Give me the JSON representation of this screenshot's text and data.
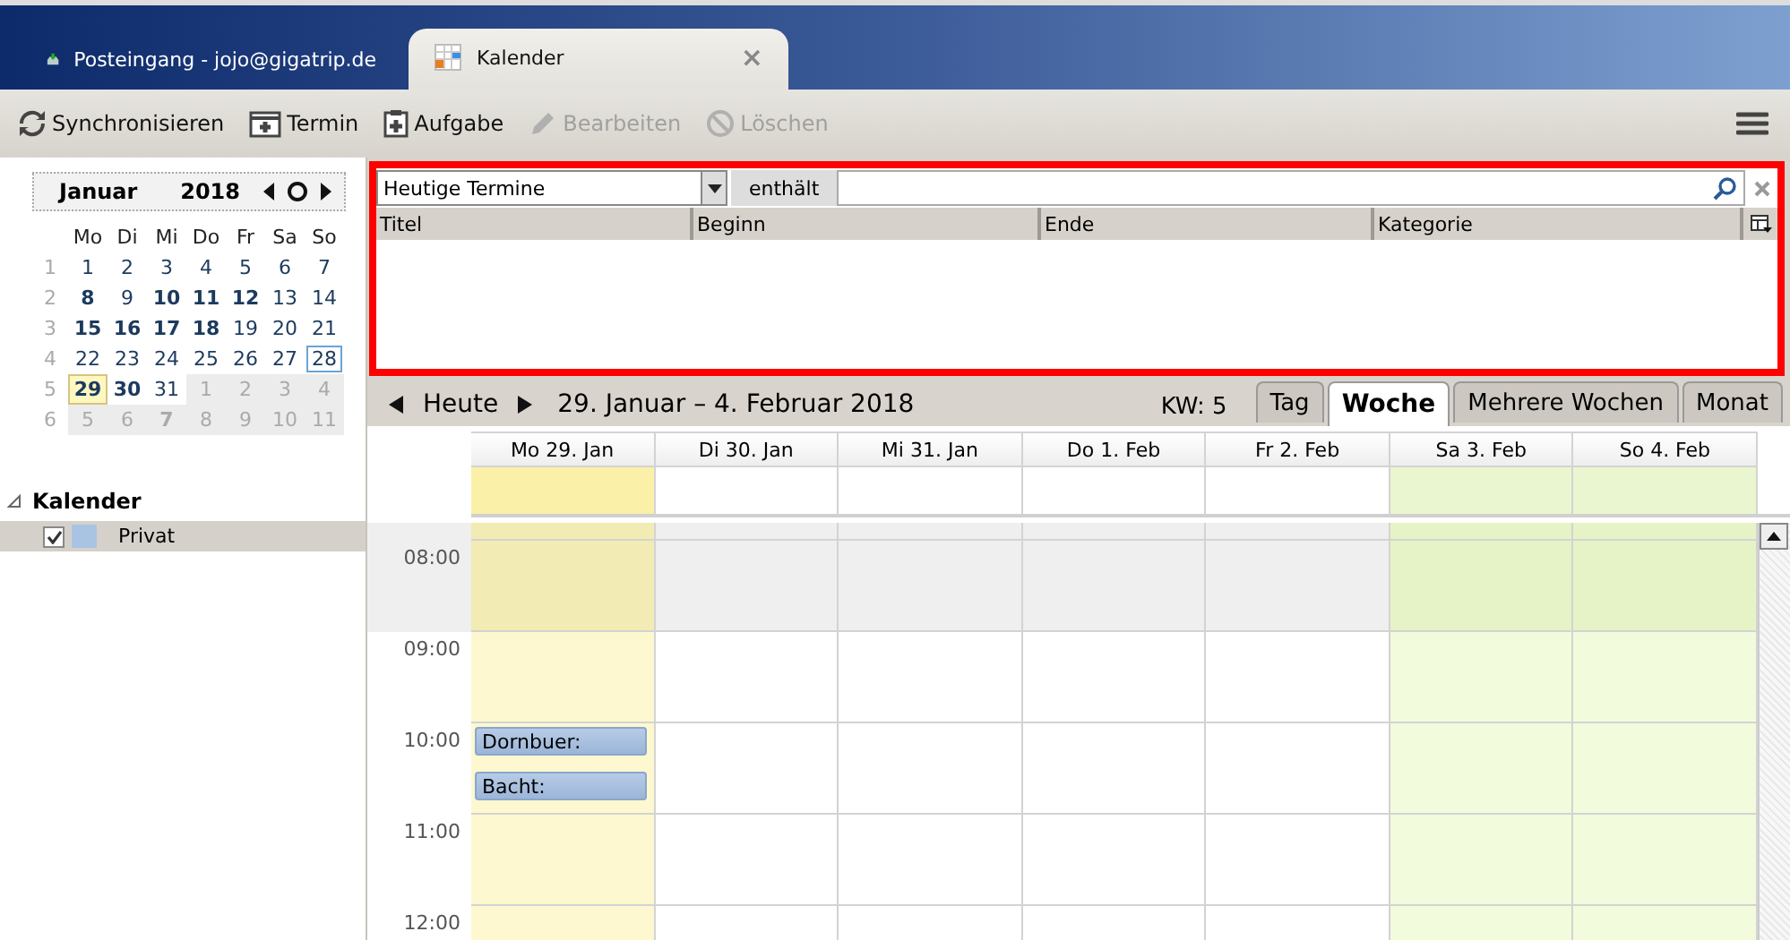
{
  "tabs": [
    {
      "label": "Posteingang - jojo@gigatrip.de",
      "kind": "mail",
      "selected": false
    },
    {
      "label": "Kalender",
      "kind": "calendar",
      "selected": true,
      "close": "×"
    }
  ],
  "toolbar": [
    {
      "label": "Synchronisieren",
      "kind": "sync",
      "disabled": false
    },
    {
      "label": "Termin",
      "kind": "event",
      "disabled": false
    },
    {
      "label": "Aufgabe",
      "kind": "task",
      "disabled": false
    },
    {
      "label": "Bearbeiten",
      "kind": "edit",
      "disabled": true
    },
    {
      "label": "Löschen",
      "kind": "delete",
      "disabled": true
    }
  ],
  "minicalendar": {
    "month": "Januar",
    "year": "2018",
    "weekdays": [
      "Mo",
      "Di",
      "Mi",
      "Do",
      "Fr",
      "Sa",
      "So"
    ],
    "weeks": [
      {
        "number": "1",
        "days": [
          {
            "day": "1",
            "bold": false,
            "outside": false,
            "today": false,
            "selected": false
          },
          {
            "day": "2",
            "bold": false,
            "outside": false,
            "today": false,
            "selected": false
          },
          {
            "day": "3",
            "bold": false,
            "outside": false,
            "today": false,
            "selected": false
          },
          {
            "day": "4",
            "bold": false,
            "outside": false,
            "today": false,
            "selected": false
          },
          {
            "day": "5",
            "bold": false,
            "outside": false,
            "today": false,
            "selected": false
          },
          {
            "day": "6",
            "bold": false,
            "outside": false,
            "today": false,
            "selected": false
          },
          {
            "day": "7",
            "bold": false,
            "outside": false,
            "today": false,
            "selected": false
          }
        ]
      },
      {
        "number": "2",
        "days": [
          {
            "day": "8",
            "bold": true,
            "outside": false,
            "today": false,
            "selected": false
          },
          {
            "day": "9",
            "bold": false,
            "outside": false,
            "today": false,
            "selected": false
          },
          {
            "day": "10",
            "bold": true,
            "outside": false,
            "today": false,
            "selected": false
          },
          {
            "day": "11",
            "bold": true,
            "outside": false,
            "today": false,
            "selected": false
          },
          {
            "day": "12",
            "bold": true,
            "outside": false,
            "today": false,
            "selected": false
          },
          {
            "day": "13",
            "bold": false,
            "outside": false,
            "today": false,
            "selected": false
          },
          {
            "day": "14",
            "bold": false,
            "outside": false,
            "today": false,
            "selected": false
          }
        ]
      },
      {
        "number": "3",
        "days": [
          {
            "day": "15",
            "bold": true,
            "outside": false,
            "today": false,
            "selected": false
          },
          {
            "day": "16",
            "bold": true,
            "outside": false,
            "today": false,
            "selected": false
          },
          {
            "day": "17",
            "bold": true,
            "outside": false,
            "today": false,
            "selected": false
          },
          {
            "day": "18",
            "bold": true,
            "outside": false,
            "today": false,
            "selected": false
          },
          {
            "day": "19",
            "bold": false,
            "outside": false,
            "today": false,
            "selected": false
          },
          {
            "day": "20",
            "bold": false,
            "outside": false,
            "today": false,
            "selected": false
          },
          {
            "day": "21",
            "bold": false,
            "outside": false,
            "today": false,
            "selected": false
          }
        ]
      },
      {
        "number": "4",
        "days": [
          {
            "day": "22",
            "bold": false,
            "outside": false,
            "today": false,
            "selected": false
          },
          {
            "day": "23",
            "bold": false,
            "outside": false,
            "today": false,
            "selected": false
          },
          {
            "day": "24",
            "bold": false,
            "outside": false,
            "today": false,
            "selected": false
          },
          {
            "day": "25",
            "bold": false,
            "outside": false,
            "today": false,
            "selected": false
          },
          {
            "day": "26",
            "bold": false,
            "outside": false,
            "today": false,
            "selected": false
          },
          {
            "day": "27",
            "bold": false,
            "outside": false,
            "today": false,
            "selected": false
          },
          {
            "day": "28",
            "bold": false,
            "outside": false,
            "today": false,
            "selected": true
          }
        ]
      },
      {
        "number": "5",
        "days": [
          {
            "day": "29",
            "bold": true,
            "outside": false,
            "today": true,
            "selected": false
          },
          {
            "day": "30",
            "bold": true,
            "outside": false,
            "today": false,
            "selected": false
          },
          {
            "day": "31",
            "bold": false,
            "outside": false,
            "today": false,
            "selected": false
          },
          {
            "day": "1",
            "bold": false,
            "outside": true,
            "today": false,
            "selected": false
          },
          {
            "day": "2",
            "bold": false,
            "outside": true,
            "today": false,
            "selected": false
          },
          {
            "day": "3",
            "bold": false,
            "outside": true,
            "today": false,
            "selected": false
          },
          {
            "day": "4",
            "bold": false,
            "outside": true,
            "today": false,
            "selected": false
          }
        ]
      },
      {
        "number": "6",
        "days": [
          {
            "day": "5",
            "bold": false,
            "outside": true,
            "today": false,
            "selected": false
          },
          {
            "day": "6",
            "bold": false,
            "outside": true,
            "today": false,
            "selected": false
          },
          {
            "day": "7",
            "bold": true,
            "outside": true,
            "today": false,
            "selected": false
          },
          {
            "day": "8",
            "bold": false,
            "outside": true,
            "today": false,
            "selected": false
          },
          {
            "day": "9",
            "bold": false,
            "outside": true,
            "today": false,
            "selected": false
          },
          {
            "day": "10",
            "bold": false,
            "outside": true,
            "today": false,
            "selected": false
          },
          {
            "day": "11",
            "bold": false,
            "outside": true,
            "today": false,
            "selected": false
          }
        ]
      }
    ]
  },
  "calendars": {
    "title": "Kalender",
    "expanded": true,
    "items": [
      {
        "name": "Privat",
        "checked": true,
        "selected": true,
        "color": "#a9c3e2"
      }
    ]
  },
  "search": {
    "filter": "Heutige Termine",
    "operator": "enthält",
    "columns": [
      "Titel",
      "Beginn",
      "Ende",
      "Kategorie"
    ]
  },
  "navigation": {
    "today": "Heute",
    "range": "29. Januar – 4. Februar 2018",
    "week": "KW: 5",
    "views": [
      {
        "label": "Tag",
        "selected": false
      },
      {
        "label": "Woche",
        "selected": true
      },
      {
        "label": "Mehrere Wochen",
        "selected": false
      },
      {
        "label": "Monat",
        "selected": false
      }
    ]
  },
  "week": {
    "days": [
      {
        "label": "Mo 29. Jan",
        "today": true,
        "weekend": false
      },
      {
        "label": "Di 30. Jan",
        "today": false,
        "weekend": false
      },
      {
        "label": "Mi 31. Jan",
        "today": false,
        "weekend": false
      },
      {
        "label": "Do 1. Feb",
        "today": false,
        "weekend": false
      },
      {
        "label": "Fr 2. Feb",
        "today": false,
        "weekend": false
      },
      {
        "label": "Sa 3. Feb",
        "today": false,
        "weekend": true
      },
      {
        "label": "So 4. Feb",
        "today": false,
        "weekend": true
      }
    ],
    "hours": [
      {
        "label": "08:00",
        "off": true
      },
      {
        "label": "09:00",
        "off": false
      },
      {
        "label": "10:00",
        "off": false,
        "events": [
          "Dornbuer:",
          "Bacht:"
        ]
      },
      {
        "label": "11:00",
        "off": false
      },
      {
        "label": "12:00",
        "off": false
      }
    ]
  }
}
